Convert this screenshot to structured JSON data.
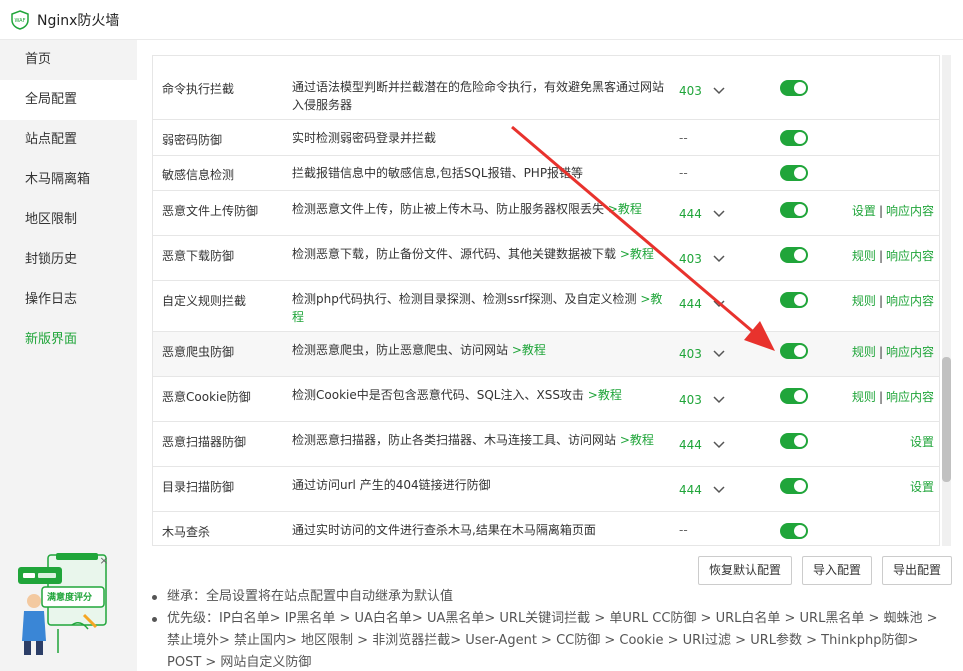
{
  "app": {
    "title": "Nginx防火墙",
    "logo_text": "WAF"
  },
  "sidebar": {
    "items": [
      {
        "label": "首页"
      },
      {
        "label": "全局配置"
      },
      {
        "label": "站点配置"
      },
      {
        "label": "木马隔离箱"
      },
      {
        "label": "地区限制"
      },
      {
        "label": "封锁历史"
      },
      {
        "label": "操作日志"
      },
      {
        "label": "新版界面"
      }
    ],
    "active_index": 1
  },
  "feedback": {
    "label": "满意度评分"
  },
  "table": {
    "rows": [
      {
        "name": "命令执行拦截",
        "desc": "通过语法模型判断并拦截潜在的危险命令执行，有效避免黑客通过网站入侵服务器",
        "code": "403",
        "ops": []
      },
      {
        "name": "弱密码防御",
        "desc": "实时检测弱密码登录并拦截",
        "code": "--",
        "ops": []
      },
      {
        "name": "敏感信息检测",
        "desc": "拦截报错信息中的敏感信息,包括SQL报错、PHP报错等",
        "code": "--",
        "ops": []
      },
      {
        "name": "恶意文件上传防御",
        "desc": "检测恶意文件上传，防止被上传木马、防止服务器权限丢失",
        "tutorial": ">教程",
        "code": "444",
        "ops": [
          "设置",
          "响应内容"
        ]
      },
      {
        "name": "恶意下载防御",
        "desc": "检测恶意下载，防止备份文件、源代码、其他关键数据被下载",
        "tutorial": ">教程",
        "code": "403",
        "ops": [
          "规则",
          "响应内容"
        ]
      },
      {
        "name": "自定义规则拦截",
        "desc": "检测php代码执行、检测目录探测、检测ssrf探测、及自定义检测",
        "tutorial": ">教程",
        "code": "444",
        "ops": [
          "规则",
          "响应内容"
        ]
      },
      {
        "name": "恶意爬虫防御",
        "desc": "检测恶意爬虫，防止恶意爬虫、访问网站",
        "tutorial": ">教程",
        "code": "403",
        "ops": [
          "规则",
          "响应内容"
        ]
      },
      {
        "name": "恶意Cookie防御",
        "desc": "检测Cookie中是否包含恶意代码、SQL注入、XSS攻击",
        "tutorial": ">教程",
        "code": "403",
        "ops": [
          "规则",
          "响应内容"
        ]
      },
      {
        "name": "恶意扫描器防御",
        "desc": "检测恶意扫描器，防止各类扫描器、木马连接工具、访问网站",
        "tutorial": ">教程",
        "code": "444",
        "ops": [
          "设置"
        ]
      },
      {
        "name": "目录扫描防御",
        "desc": "通过访问url 产生的404链接进行防御",
        "code": "444",
        "ops": [
          "设置"
        ]
      },
      {
        "name": "木马查杀",
        "desc": "通过实时访问的文件进行查杀木马,结果在木马隔离箱页面",
        "code": "--",
        "ops": []
      }
    ]
  },
  "buttons": {
    "restore": "恢复默认配置",
    "import": "导入配置",
    "export": "导出配置"
  },
  "notes": [
    "继承：全局设置将在站点配置中自动继承为默认值",
    "优先级：IP白名单> IP黑名单 > UA白名单> UA黑名单> URL关键词拦截 > 单URL CC防御 > URL白名单 > URL黑名单 > 蜘蛛池 > 禁止境外> 禁止国内> 地区限制 > 非浏览器拦截> User-Agent > CC防御 > Cookie > URI过滤 > URL参数 > Thinkphp防御> POST > 网站自定义防御"
  ],
  "colors": {
    "accent": "#20a53a",
    "arrow": "#e8322d"
  }
}
